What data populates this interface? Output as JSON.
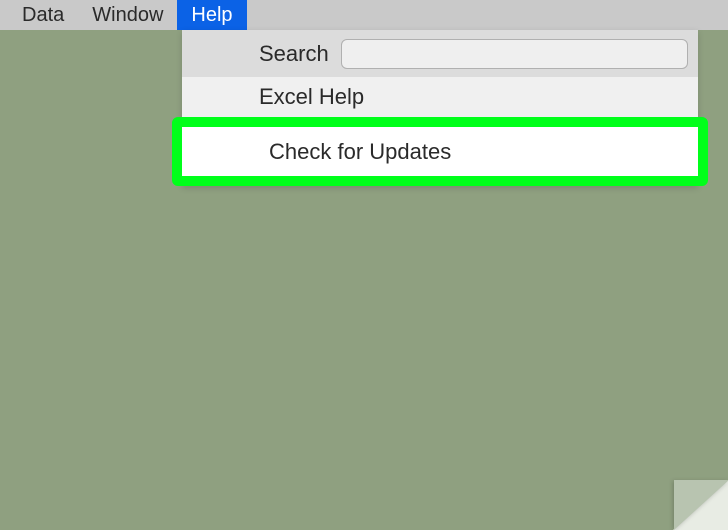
{
  "menubar": {
    "items": [
      "Data",
      "Window",
      "Help"
    ],
    "selected": "Help"
  },
  "dropdown": {
    "search_label": "Search",
    "search_placeholder": "",
    "items": [
      {
        "label": "Excel Help",
        "highlighted": false
      },
      {
        "label": "Check for Updates",
        "highlighted": true
      }
    ]
  }
}
